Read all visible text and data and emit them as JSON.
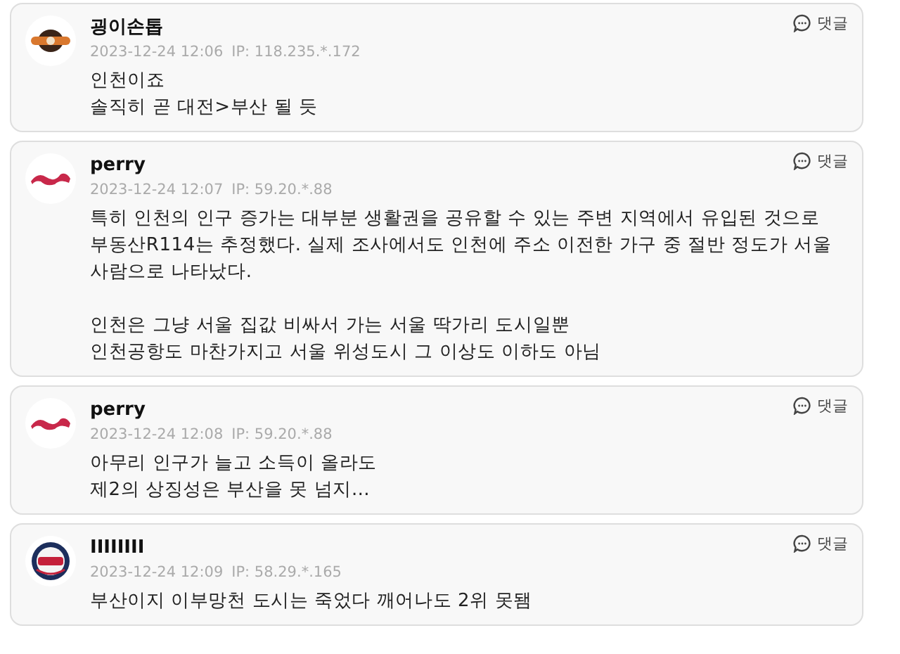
{
  "comments": [
    {
      "avatar": {
        "kind": "oval"
      },
      "name": "굉이손톱",
      "date": "2023-12-24 12:06",
      "ip": "IP: 118.235.*.172",
      "reply": "댓글",
      "paragraphs": [
        [
          "인천이죠",
          "솔직히 곧 대전>부산 될 듯"
        ]
      ]
    },
    {
      "avatar": {
        "kind": "script"
      },
      "name": "perry",
      "date": "2023-12-24 12:07",
      "ip": "IP: 59.20.*.88",
      "reply": "댓글",
      "paragraphs": [
        [
          "특히 인천의 인구 증가는 대부분 생활권을 공유할 수 있는 주변 지역에서 유입된 것으로",
          "부동산R114는 추정했다. 실제 조사에서도 인천에 주소 이전한 가구 중 절반 정도가 서울",
          "사람으로 나타났다."
        ],
        [
          "인천은 그냥 서울 집값 비싸서 가는 서울 딱가리 도시일뿐",
          "인천공항도 마찬가지고 서울 위성도시 그 이상도 이하도 아님"
        ]
      ]
    },
    {
      "avatar": {
        "kind": "script"
      },
      "name": "perry",
      "date": "2023-12-24 12:08",
      "ip": "IP: 59.20.*.88",
      "reply": "댓글",
      "paragraphs": [
        [
          "아무리 인구가 늘고 소득이 올라도",
          "제2의 상징성은 부산을 못 넘지…"
        ]
      ]
    },
    {
      "avatar": {
        "kind": "roundel"
      },
      "name": "IIIIIIII",
      "date": "2023-12-24 12:09",
      "ip": "IP: 58.29.*.165",
      "reply": "댓글",
      "paragraphs": [
        [
          "부산이지 이부망천 도시는 죽었다 깨어나도 2위 못됌"
        ]
      ]
    }
  ]
}
